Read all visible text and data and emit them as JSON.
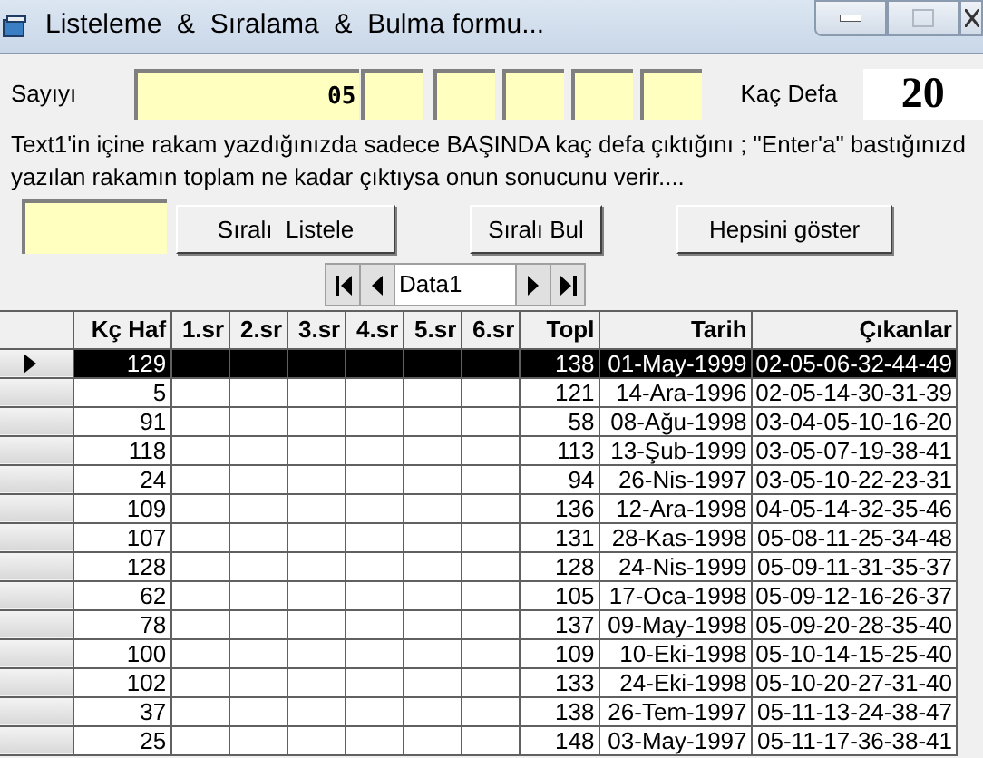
{
  "window": {
    "title": "Listeleme  &  Sıralama  &  Bulma formu..."
  },
  "number_label": "Sayıyı",
  "number_fields": [
    {
      "kind": "main",
      "value": "05"
    },
    {
      "kind": "digit"
    },
    {
      "kind": "digit"
    },
    {
      "kind": "digit"
    },
    {
      "kind": "digit"
    },
    {
      "kind": "digit"
    }
  ],
  "count_label": "Kaç Defa",
  "count_value": "20",
  "help_lines": [
    "Text1'in içine rakam yazdığınızda sadece BAŞINDA kaç defa çıktığını ; \"Enter'a\" bastığınızd",
    "yazılan rakamın  toplam  ne kadar çıktıysa onun sonucunu  verir...."
  ],
  "buttons": [
    "Sıralı  Listele",
    "Sıralı Bul",
    "Hepsini göster"
  ],
  "data_control": {
    "caption": "Data1"
  },
  "table": {
    "columns": [
      "Kç Haf",
      "1.sr",
      "2.sr",
      "3.sr",
      "4.sr",
      "5.sr",
      "6.sr",
      "Topl",
      "Tarih",
      "Çıkanlar"
    ],
    "rows": [
      {
        "selected": true,
        "cells": [
          "129",
          "",
          "",
          "",
          "",
          "",
          "",
          "138",
          "01-May-1999",
          "02-05-06-32-44-49"
        ]
      },
      {
        "selected": false,
        "cells": [
          "5",
          "",
          "",
          "",
          "",
          "",
          "",
          "121",
          "14-Ara-1996",
          "02-05-14-30-31-39"
        ]
      },
      {
        "selected": false,
        "cells": [
          "91",
          "",
          "",
          "",
          "",
          "",
          "",
          "58",
          "08-Ağu-1998",
          "03-04-05-10-16-20"
        ]
      },
      {
        "selected": false,
        "cells": [
          "118",
          "",
          "",
          "",
          "",
          "",
          "",
          "113",
          "13-Şub-1999",
          "03-05-07-19-38-41"
        ]
      },
      {
        "selected": false,
        "cells": [
          "24",
          "",
          "",
          "",
          "",
          "",
          "",
          "94",
          "26-Nis-1997",
          "03-05-10-22-23-31"
        ]
      },
      {
        "selected": false,
        "cells": [
          "109",
          "",
          "",
          "",
          "",
          "",
          "",
          "136",
          "12-Ara-1998",
          "04-05-14-32-35-46"
        ]
      },
      {
        "selected": false,
        "cells": [
          "107",
          "",
          "",
          "",
          "",
          "",
          "",
          "131",
          "28-Kas-1998",
          "05-08-11-25-34-48"
        ]
      },
      {
        "selected": false,
        "cells": [
          "128",
          "",
          "",
          "",
          "",
          "",
          "",
          "128",
          "24-Nis-1999",
          "05-09-11-31-35-37"
        ]
      },
      {
        "selected": false,
        "cells": [
          "62",
          "",
          "",
          "",
          "",
          "",
          "",
          "105",
          "17-Oca-1998",
          "05-09-12-16-26-37"
        ]
      },
      {
        "selected": false,
        "cells": [
          "78",
          "",
          "",
          "",
          "",
          "",
          "",
          "137",
          "09-May-1998",
          "05-09-20-28-35-40"
        ]
      },
      {
        "selected": false,
        "cells": [
          "100",
          "",
          "",
          "",
          "",
          "",
          "",
          "109",
          "10-Eki-1998",
          "05-10-14-15-25-40"
        ]
      },
      {
        "selected": false,
        "cells": [
          "102",
          "",
          "",
          "",
          "",
          "",
          "",
          "133",
          "24-Eki-1998",
          "05-10-20-27-31-40"
        ]
      },
      {
        "selected": false,
        "cells": [
          "37",
          "",
          "",
          "",
          "",
          "",
          "",
          "138",
          "26-Tem-1997",
          "05-11-13-24-38-47"
        ]
      },
      {
        "selected": false,
        "cells": [
          "25",
          "",
          "",
          "",
          "",
          "",
          "",
          "148",
          "03-May-1997",
          "05-11-17-36-38-41"
        ]
      }
    ]
  }
}
